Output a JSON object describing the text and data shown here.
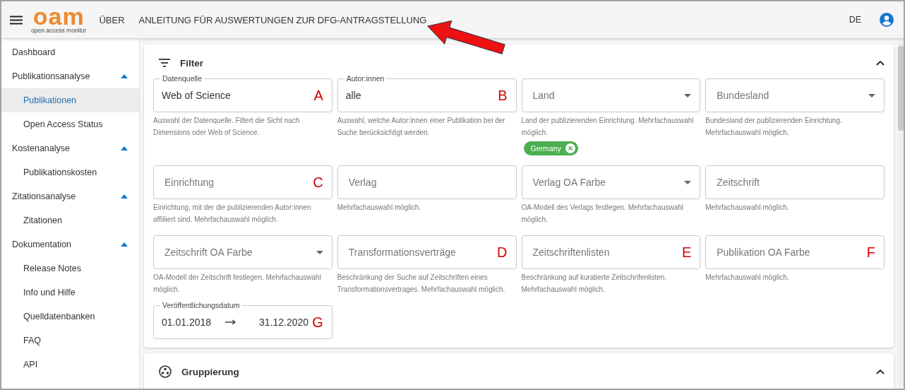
{
  "header": {
    "logo": {
      "mark": "oam",
      "subtitle": "open access monitor"
    },
    "nav": [
      "ÜBER",
      "ANLEITUNG FÜR AUSWERTUNGEN ZUR DFG-ANTRAGSTELLUNG"
    ],
    "language": "DE"
  },
  "sidebar": {
    "items": [
      {
        "label": "Dashboard",
        "selected": false
      },
      {
        "label": "Publikationsanalyse",
        "selected": false,
        "expanded": true,
        "children": [
          {
            "label": "Publikationen",
            "selected": true
          },
          {
            "label": "Open Access Status",
            "selected": false
          }
        ]
      },
      {
        "label": "Kostenanalyse",
        "selected": false,
        "expanded": true,
        "children": [
          {
            "label": "Publikationskosten",
            "selected": false
          }
        ]
      },
      {
        "label": "Zitationsanalyse",
        "selected": false,
        "expanded": true,
        "children": [
          {
            "label": "Zitationen",
            "selected": false
          }
        ]
      },
      {
        "label": "Dokumentation",
        "selected": false,
        "expanded": true,
        "children": [
          {
            "label": "Release Notes",
            "selected": false
          },
          {
            "label": "Info und Hilfe",
            "selected": false
          },
          {
            "label": "Quelldatenbanken",
            "selected": false
          },
          {
            "label": "FAQ",
            "selected": false
          },
          {
            "label": "API",
            "selected": false
          }
        ]
      }
    ]
  },
  "sections": [
    {
      "title": "Filter",
      "expanded": true,
      "fields": [
        {
          "kind": "text",
          "label": "Datenquelle",
          "value": "Web of Science",
          "marker": "A",
          "helper": "Auswahl der Datenquelle. Filtert die Sicht nach Dimensions oder Web of Science."
        },
        {
          "kind": "text",
          "label": "Autor:innen",
          "value": "alle",
          "marker": "B",
          "helper": "Auswahl, welche Autor:innen einer Publikation bei der Suche berücksichtigt werden."
        },
        {
          "kind": "select",
          "placeholder": "Land",
          "helper": "Land der publizierenden Einrichtung. Mehrfachauswahl möglich.",
          "chips": [
            {
              "label": "Germany"
            }
          ]
        },
        {
          "kind": "select",
          "placeholder": "Bundesland",
          "helper": "Bundesland der publizierenden Einrichtung. Mehrfachauswahl möglich."
        },
        {
          "kind": "text",
          "placeholder": "Einrichtung",
          "marker": "C",
          "helper": "Einrichtung, mit der die publizierenden Autor:innen affiliiert sind. Mehrfachauswahl möglich."
        },
        {
          "kind": "text",
          "placeholder": "Verlag",
          "helper": "Mehrfachauswahl möglich."
        },
        {
          "kind": "select",
          "placeholder": "Verlag OA Farbe",
          "helper": "OA-Modell des Verlags festlegen. Mehrfachauswahl möglich."
        },
        {
          "kind": "text",
          "placeholder": "Zeitschrift",
          "helper": "Mehrfachauswahl möglich."
        },
        {
          "kind": "select",
          "placeholder": "Zeitschrift OA Farbe",
          "helper": "OA-Modell der Zeitschrift festlegen. Mehrfachauswahl möglich."
        },
        {
          "kind": "text",
          "placeholder": "Transformationsverträge",
          "marker": "D",
          "helper": "Beschränkung der Suche auf Zeitschriften eines Transformationsvertrages. Mehrfachauswahl möglich."
        },
        {
          "kind": "text",
          "placeholder": "Zeitschriftenlisten",
          "marker": "E",
          "helper": "Beschränkung auf kuratierte Zeitschrifenlisten. Mehrfachauswahl möglich."
        },
        {
          "kind": "text",
          "placeholder": "Publikation OA Farbe",
          "marker": "F",
          "helper": "Mehrfachauswahl möglich."
        },
        {
          "kind": "daterange",
          "label": "Veröffentlichungsdatum",
          "from": "01.01.2018",
          "to": "31.12.2020",
          "marker": "G"
        }
      ]
    },
    {
      "title": "Gruppierung",
      "expanded": true
    }
  ]
}
